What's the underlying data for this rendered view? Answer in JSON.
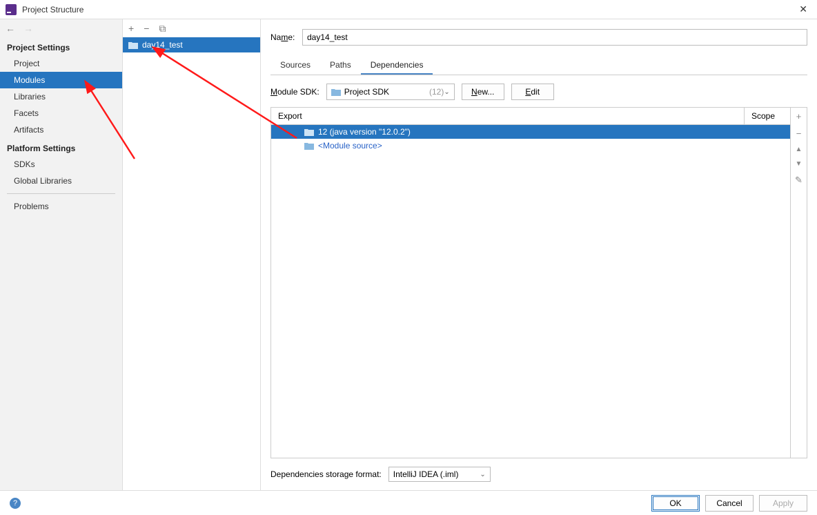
{
  "window": {
    "title": "Project Structure",
    "close": "✕"
  },
  "nav": {
    "back": "←",
    "forward": "→"
  },
  "sidebar": {
    "project_settings_header": "Project Settings",
    "project_items": [
      "Project",
      "Modules",
      "Libraries",
      "Facets",
      "Artifacts"
    ],
    "platform_settings_header": "Platform Settings",
    "platform_items": [
      "SDKs",
      "Global Libraries"
    ],
    "problems": "Problems"
  },
  "module_toolbar": {
    "add": "+",
    "remove": "−",
    "copy": "⧉"
  },
  "module_list": {
    "selected": "day14_test"
  },
  "name": {
    "label_pre": "Na",
    "label_u": "m",
    "label_post": "e:",
    "value": "day14_test"
  },
  "tabs": {
    "sources": "Sources",
    "paths": "Paths",
    "dependencies": "Dependencies"
  },
  "sdk": {
    "label_u": "M",
    "label_post": "odule SDK:",
    "selected": "Project SDK",
    "hint": "(12)",
    "new_u": "N",
    "new_post": "ew...",
    "edit_u": "E",
    "edit_post": "dit"
  },
  "deps": {
    "col_export": "Export",
    "col_scope": "Scope",
    "rows": [
      {
        "text": "12 (java version \"12.0.2\")",
        "selected": true,
        "module_src": false
      },
      {
        "text": "<Module source>",
        "selected": false,
        "module_src": true
      }
    ],
    "side": {
      "add": "+",
      "remove": "−",
      "up": "▲",
      "down": "▼",
      "edit": "✎"
    }
  },
  "storage": {
    "label": "Dependencies storage format:",
    "value": "IntelliJ IDEA (.iml)"
  },
  "footer": {
    "help": "?",
    "ok": "OK",
    "cancel": "Cancel",
    "apply": "Apply"
  }
}
